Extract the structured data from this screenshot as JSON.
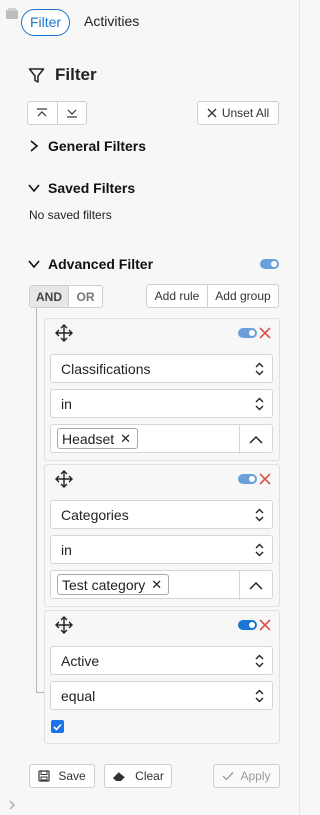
{
  "tabs": [
    {
      "label": "Filter",
      "active": true
    },
    {
      "label": "Activities",
      "active": false
    }
  ],
  "title": "Filter",
  "toolbar": {
    "unset_all": "Unset All"
  },
  "sections": {
    "general": "General Filters",
    "saved": "Saved Filters",
    "saved_empty": "No saved filters",
    "advanced": "Advanced Filter"
  },
  "combinator": {
    "and": "AND",
    "or": "OR"
  },
  "actions": {
    "add_rule": "Add rule",
    "add_group": "Add group"
  },
  "rules": [
    {
      "field": "Classifications",
      "operator": "in",
      "value_chip": "Headset",
      "enabled": true
    },
    {
      "field": "Categories",
      "operator": "in",
      "value_chip": "Test category",
      "enabled": true
    },
    {
      "field": "Active",
      "operator": "equal",
      "checkbox_checked": true,
      "enabled": true
    }
  ],
  "footer": {
    "save": "Save",
    "clear": "Clear",
    "apply": "Apply"
  },
  "colors": {
    "accent": "#1976d2",
    "toggle": "#6a9fd8",
    "remove": "#d9534f",
    "background": "#f7f7f7"
  },
  "icons": [
    "filter-icon",
    "collapse-all-icon",
    "expand-all-icon",
    "close-icon",
    "chevron-right-icon",
    "chevron-down-icon",
    "move-icon",
    "select-arrows-icon",
    "chevron-up-icon",
    "save-icon",
    "eraser-icon",
    "check-icon"
  ]
}
